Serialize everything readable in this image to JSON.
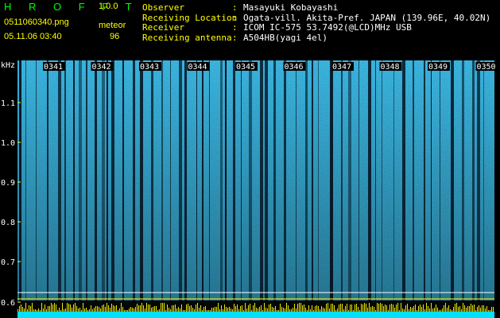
{
  "app": {
    "name": "H R O F F T",
    "version": "1.0.0"
  },
  "file": {
    "name": "0511060340.png",
    "datetime": "05.11.06 03:40"
  },
  "detection": {
    "label": "meteor",
    "count": "96"
  },
  "info_rows": [
    {
      "key": "Observer",
      "value": "Masayuki Kobayashi"
    },
    {
      "key": "Receiving Location",
      "value": "Ogata-vill. Akita-Pref. JAPAN (139.96E, 40.02N)"
    },
    {
      "key": "Receiver",
      "value": "ICOM IC-575 53.7492(@LCD)MHz USB"
    },
    {
      "key": "Receiving antenna",
      "value": "A504HB(yagi 4el)"
    }
  ],
  "axis": {
    "unit": "kHz",
    "y_ticks": [
      "1.1",
      "1.0",
      "0.9",
      "0.8",
      "0.7",
      "0.6"
    ],
    "time_labels": [
      "0341",
      "0342",
      "0343",
      "0344",
      "0345",
      "0346",
      "0347",
      "0348",
      "0349",
      "0350"
    ]
  },
  "colors": {
    "header_text_yellow": "#ffff00",
    "header_text_green": "#00ff00",
    "header_text_white": "#ffffff",
    "spectrogram_bg": "#1a4fa0",
    "axis_text": "#ffffff",
    "tick_color": "#ffff00"
  }
}
